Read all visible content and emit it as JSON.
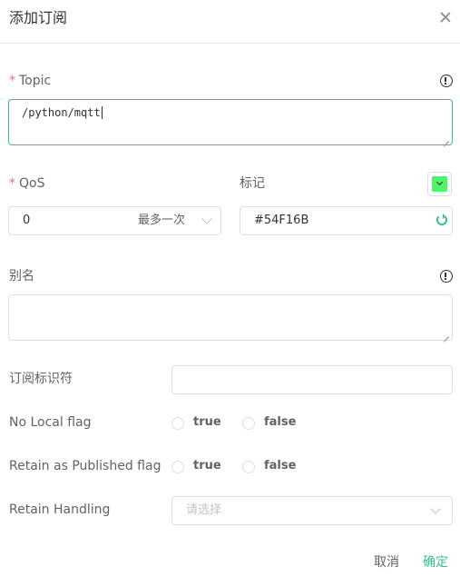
{
  "dialog": {
    "title": "添加订阅",
    "close_icon": "close-icon"
  },
  "topic": {
    "label": "Topic",
    "required_mark": "*",
    "value": "/python/mqtt",
    "info_icon": "info-circle-icon"
  },
  "qos": {
    "label": "QoS",
    "required_mark": "*",
    "value": "0",
    "value_desc": "最多一次"
  },
  "mark": {
    "label": "标记",
    "color_value": "#54F16B",
    "swatch_color": "#54F16B"
  },
  "alias": {
    "label": "别名",
    "value": "",
    "info_icon": "info-circle-icon"
  },
  "subscription_identifier": {
    "label": "订阅标识符",
    "value": ""
  },
  "no_local_flag": {
    "label": "No Local flag",
    "options": [
      "true",
      "false"
    ]
  },
  "retain_as_published_flag": {
    "label": "Retain as Published flag",
    "options": [
      "true",
      "false"
    ]
  },
  "retain_handling": {
    "label": "Retain Handling",
    "placeholder": "请选择"
  },
  "footer": {
    "cancel_label": "取消",
    "confirm_label": "确定"
  },
  "colors": {
    "accent": "#34c388",
    "required": "#f56c6c",
    "border": "#dcdfe6"
  }
}
